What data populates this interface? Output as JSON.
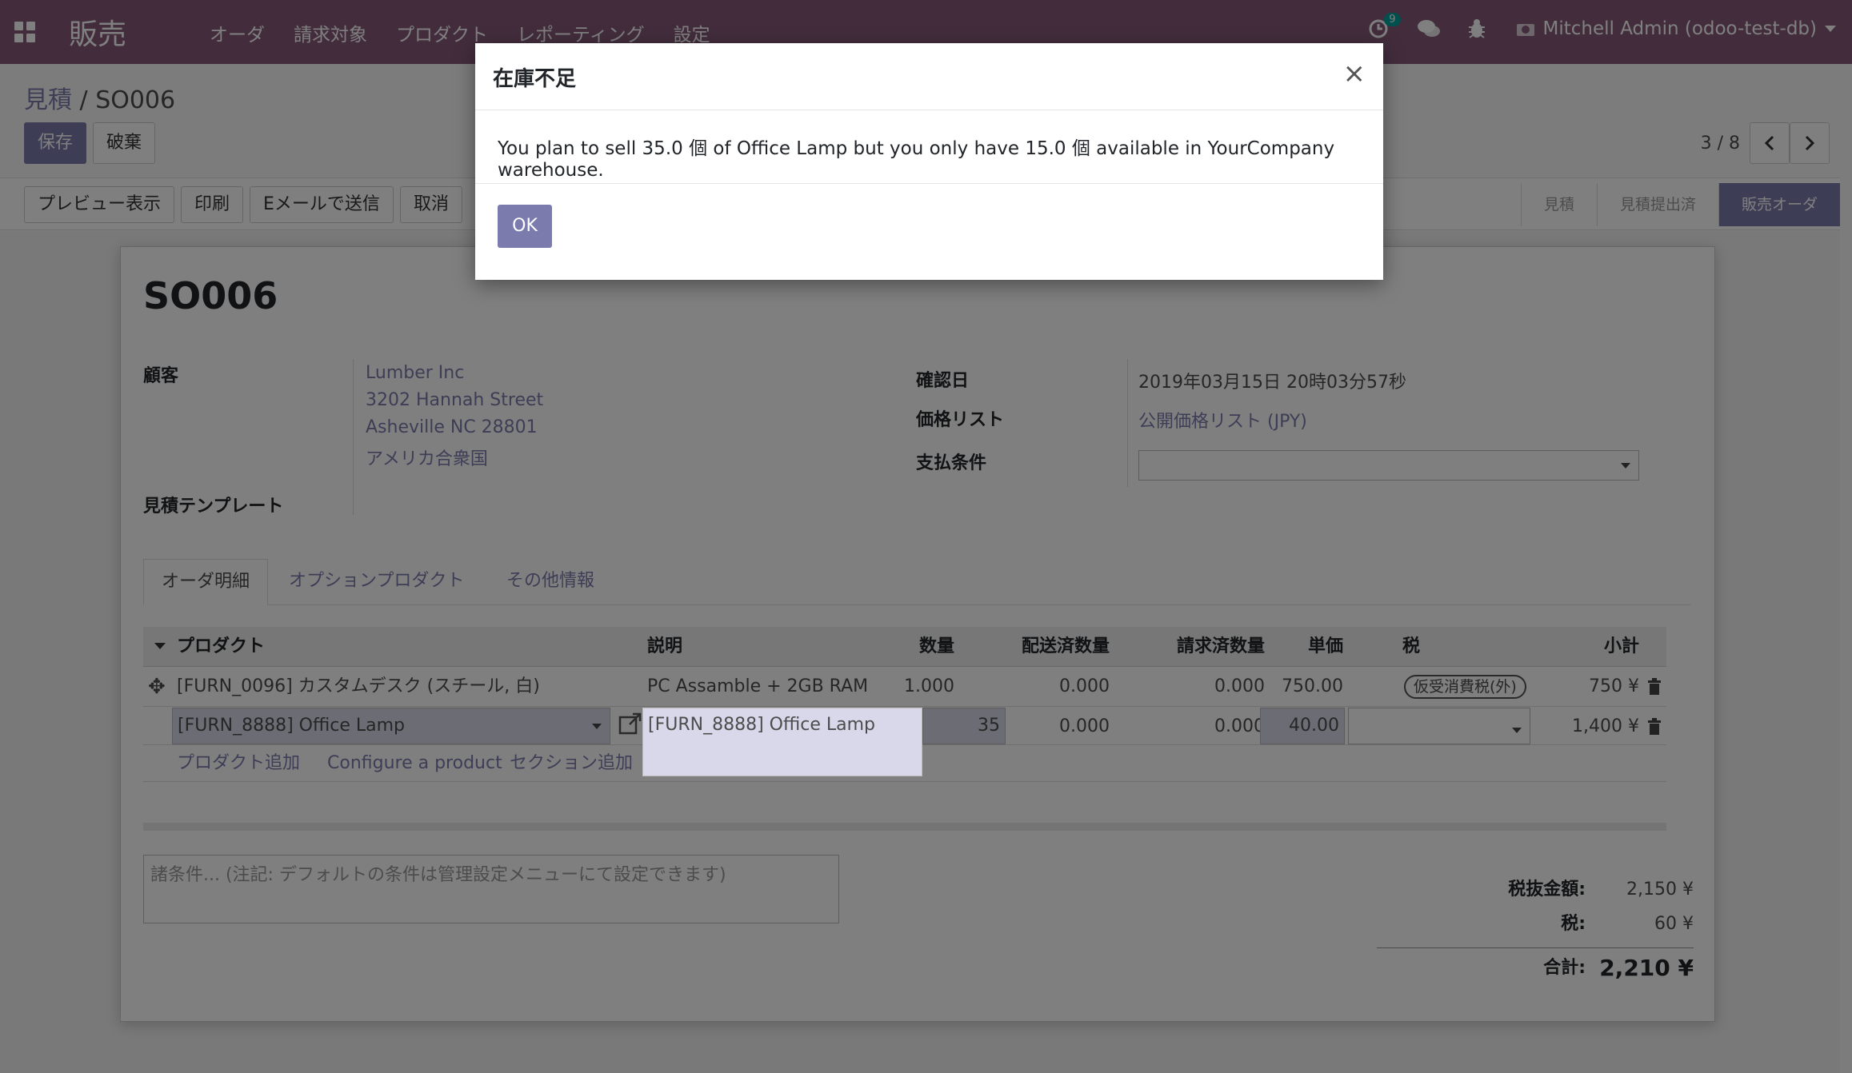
{
  "navbar": {
    "app_name": "販売",
    "menu": [
      "オーダ",
      "請求対象",
      "プロダクト",
      "レポーティング",
      "設定"
    ],
    "activity_count": "9",
    "user": "Mitchell Admin (odoo-test-db)"
  },
  "breadcrumb": {
    "parent": "見積",
    "sep": " / ",
    "current": "SO006"
  },
  "toolbar": {
    "save": "保存",
    "discard": "破棄"
  },
  "pager": {
    "value": "3 / 8"
  },
  "statusbar": {
    "buttons": [
      "プレビュー表示",
      "印刷",
      "Eメールで送信",
      "取消"
    ],
    "stages": [
      "見積",
      "見積提出済",
      "販売オーダ"
    ]
  },
  "form": {
    "title": "SO006",
    "customer_label": "顧客",
    "customer": [
      "Lumber Inc",
      "3202 Hannah Street",
      "Asheville NC 28801",
      "アメリカ合衆国"
    ],
    "template_label": "見積テンプレート",
    "confirm_date_label": "確認日",
    "confirm_date": "2019年03月15日 20時03分57秒",
    "pricelist_label": "価格リスト",
    "pricelist": "公開価格リスト (JPY)",
    "payment_terms_label": "支払条件",
    "payment_terms": ""
  },
  "tabs": [
    "オーダ明細",
    "オプションプロダクト",
    "その他情報"
  ],
  "table": {
    "headers": [
      "プロダクト",
      "説明",
      "数量",
      "配送済数量",
      "請求済数量",
      "単価",
      "税",
      "小計"
    ],
    "row1": {
      "product": "[FURN_0096] カスタムデスク (スチール, 白)",
      "desc": "PC Assamble + 2GB RAM",
      "qty": "1.000",
      "delivered": "0.000",
      "invoiced": "0.000",
      "price": "750.00",
      "tax": "仮受消費税(外)",
      "subtotal": "750 ¥"
    },
    "row2": {
      "product": "[FURN_8888] Office Lamp",
      "desc": "[FURN_8888] Office Lamp",
      "qty": "35",
      "delivered": "0.000",
      "invoiced": "0.000",
      "price": "40.00",
      "tax": "",
      "subtotal": "1,400 ¥"
    },
    "actions": [
      "プロダクト追加",
      "Configure a product",
      "セクション追加"
    ]
  },
  "notes_placeholder": "諸条件... (注記: デフォルトの条件は管理設定メニューにて設定できます)",
  "totals": {
    "untaxed_label": "税抜金額:",
    "untaxed": "2,150 ¥",
    "tax_label": "税:",
    "tax": "60 ¥",
    "total_label": "合計:",
    "total": "2,210 ¥"
  },
  "modal": {
    "title": "在庫不足",
    "close": "×",
    "message": "You plan to sell 35.0 個 of Office Lamp but you only have 15.0 個 available in YourCompany warehouse.",
    "ok": "OK"
  }
}
